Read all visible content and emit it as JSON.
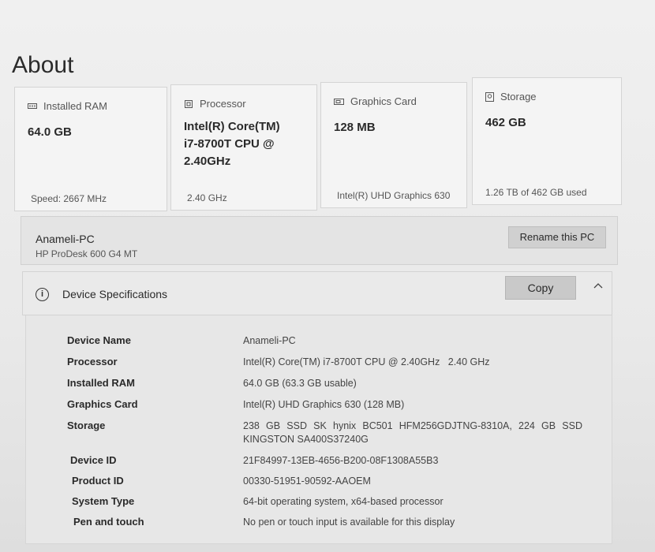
{
  "page": {
    "title": "About"
  },
  "cards": {
    "ram": {
      "label": "Installed RAM",
      "value": "64.0 GB",
      "footer": "Speed: 2667 MHz",
      "icon": "ram-icon"
    },
    "cpu": {
      "label": "Processor",
      "value": "Intel(R) Core(TM) i7-8700T CPU @ 2.40GHz",
      "footer": "2.40 GHz",
      "icon": "processor-icon"
    },
    "gpu": {
      "label": "Graphics Card",
      "value": "128 MB",
      "footer": "Intel(R) UHD Graphics 630",
      "icon": "graphics-card-icon"
    },
    "storage": {
      "label": "Storage",
      "value": "462 GB",
      "footer": "1.26 TB of 462 GB used",
      "icon": "storage-icon"
    }
  },
  "pc": {
    "name": "Anameli-PC",
    "model": "HP ProDesk 600 G4 MT",
    "rename_label": "Rename this PC"
  },
  "specs": {
    "title": "Device Specifications",
    "copy_label": "Copy",
    "info_glyph": "i",
    "rows": [
      {
        "label": "Device Name",
        "value": "Anameli-PC"
      },
      {
        "label": "Processor",
        "value": "Intel(R) Core(TM) i7-8700T CPU @ 2.40GHz   2.40 GHz"
      },
      {
        "label": "Installed RAM",
        "value": "64.0 GB (63.3 GB usable)"
      },
      {
        "label": "Graphics Card",
        "value": "Intel(R) UHD Graphics 630 (128 MB)"
      },
      {
        "label": "Storage",
        "value": "238 GB SSD SK hynix BC501 HFM256GDJTNG-8310A, 224 GB SSD KINGSTON SA400S37240G"
      },
      {
        "label": "Device ID",
        "value": "21F84997-13EB-4656-B200-08F1308A55B3"
      },
      {
        "label": "Product ID",
        "value": "00330-51951-90592-AAOEM"
      },
      {
        "label": "System Type",
        "value": "64-bit operating system, x64-based processor"
      },
      {
        "label": "Pen and touch",
        "value": "No pen or touch input is available for this display"
      }
    ]
  }
}
